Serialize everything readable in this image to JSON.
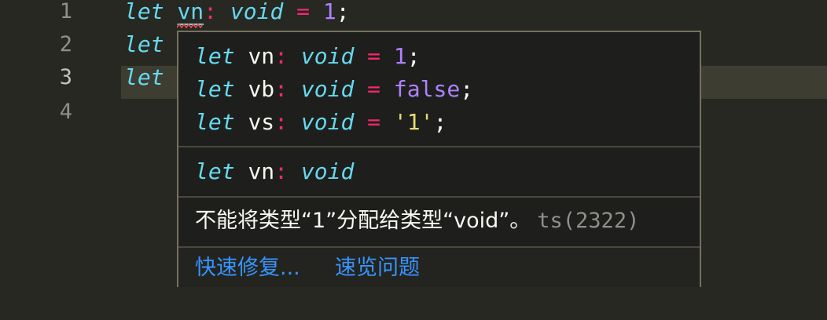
{
  "editor": {
    "lines": [
      {
        "number": "1",
        "kw": "let",
        "var": "vn",
        "colon": ":",
        "type": "void",
        "eq": "=",
        "value": "1",
        "semi": ";"
      },
      {
        "number": "2",
        "kw": "let"
      },
      {
        "number": "3",
        "kw": "let"
      },
      {
        "number": "4"
      }
    ]
  },
  "hover": {
    "signatures": [
      {
        "kw": "let",
        "name": "vn",
        "colon": ":",
        "type": "void",
        "eq": "=",
        "value": "1",
        "value_kind": "number",
        "semi": ";"
      },
      {
        "kw": "let",
        "name": "vb",
        "colon": ":",
        "type": "void",
        "eq": "=",
        "value": "false",
        "value_kind": "boolean",
        "semi": ";"
      },
      {
        "kw": "let",
        "name": "vs",
        "colon": ":",
        "type": "void",
        "eq": "=",
        "value": "'1'",
        "value_kind": "string",
        "semi": ";"
      }
    ],
    "type_info": {
      "kw": "let",
      "name": "vn",
      "colon": ":",
      "type": "void"
    },
    "error_message": "不能将类型“1”分配给类型“void”。",
    "error_code": "ts(2322)",
    "actions": {
      "quick_fix": "快速修复...",
      "peek_problem": "速览问题"
    }
  },
  "colors": {
    "background": "#272822",
    "keyword": "#66d9ef",
    "operator": "#f92672",
    "number": "#ae81ff",
    "string": "#e6db74",
    "link": "#3794ff",
    "error": "#f14c4c"
  }
}
